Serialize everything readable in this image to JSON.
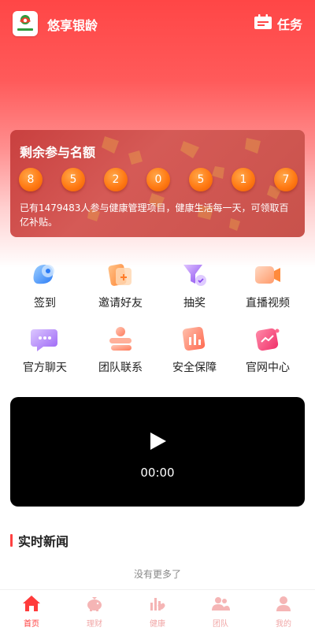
{
  "header": {
    "app_name": "悠享银龄",
    "logo_text": "悠享银龄",
    "task_label": "任务"
  },
  "quota": {
    "title": "剩余参与名额",
    "digits": [
      "8",
      "5",
      "2",
      "0",
      "5",
      "1",
      "7"
    ],
    "description": "已有1479483人参与健康管理项目，健康生活每一天，可领取百亿补贴。"
  },
  "quick_actions": [
    {
      "label": "签到",
      "icon": "checkin-icon"
    },
    {
      "label": "邀请好友",
      "icon": "invite-icon"
    },
    {
      "label": "抽奖",
      "icon": "lottery-icon"
    },
    {
      "label": "直播视频",
      "icon": "live-video-icon"
    },
    {
      "label": "官方聊天",
      "icon": "chat-icon"
    },
    {
      "label": "团队联系",
      "icon": "team-contact-icon"
    },
    {
      "label": "安全保障",
      "icon": "security-icon"
    },
    {
      "label": "官网中心",
      "icon": "website-icon"
    }
  ],
  "video": {
    "time": "00:00"
  },
  "news": {
    "title": "实时新闻",
    "empty_text": "没有更多了"
  },
  "tabbar": [
    {
      "label": "首页",
      "icon": "home-icon",
      "active": true
    },
    {
      "label": "理财",
      "icon": "piggy-bank-icon",
      "active": false
    },
    {
      "label": "健康",
      "icon": "health-icon",
      "active": false
    },
    {
      "label": "团队",
      "icon": "team-icon",
      "active": false
    },
    {
      "label": "我的",
      "icon": "profile-icon",
      "active": false
    }
  ],
  "colors": {
    "primary": "#ff4646",
    "digit_orange": "#ff7a14",
    "tab_active": "#ff3b3b",
    "tab_inactive": "#f1a7a7"
  }
}
